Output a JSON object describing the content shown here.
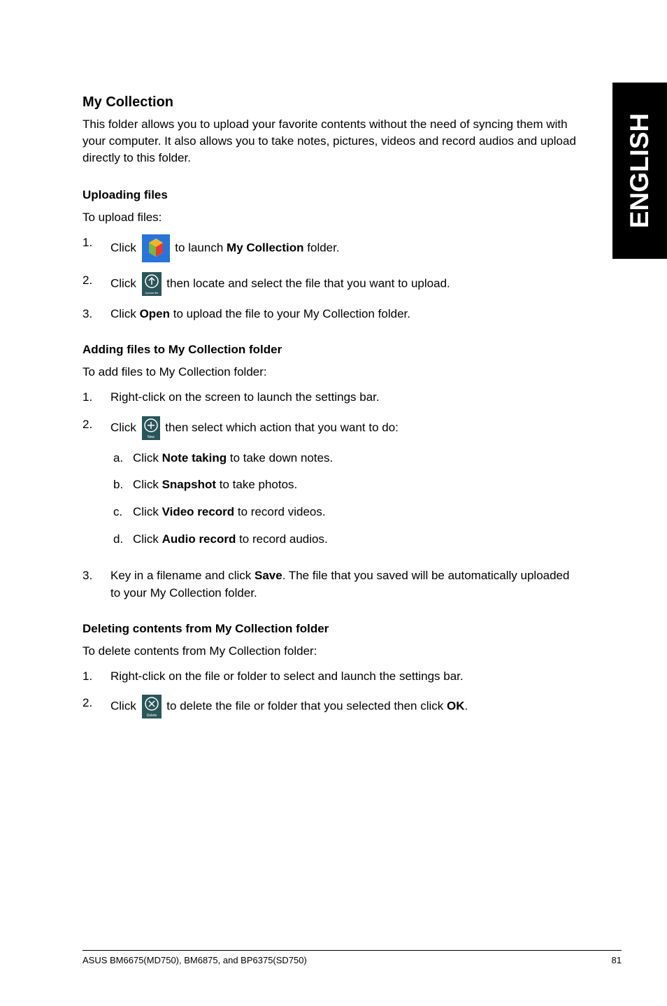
{
  "sideTab": "ENGLISH",
  "title": "My Collection",
  "intro": "This folder allows you to upload your favorite contents without the need of syncing them with your computer. It also allows you to take notes, pictures, videos and record audios and upload directly to this folder.",
  "upload": {
    "heading": "Uploading files",
    "lead": "To upload files:",
    "s1_pre": "Click ",
    "s1_post": " to launch ",
    "s1_bold": "My Collection",
    "s1_end": " folder.",
    "s2_pre": "Click ",
    "s2_post": " then locate and select the file that you want to upload.",
    "s3_a": "Click ",
    "s3_b": "Open",
    "s3_c": " to upload the file to your My Collection folder."
  },
  "adding": {
    "heading": "Adding files to My Collection folder",
    "lead": "To add files to My Collection folder:",
    "s1": "Right-click on the screen to launch the settings bar.",
    "s2_pre": "Click ",
    "s2_post": " then select which action that you want to do:",
    "a_pre": "Click ",
    "a_b": "Note taking",
    "a_post": " to take down notes.",
    "b_pre": "Click ",
    "b_b": "Snapshot",
    "b_post": " to take photos.",
    "c_pre": "Click ",
    "c_b": "Video record",
    "c_post": " to record videos.",
    "d_pre": "Click ",
    "d_b": "Audio record",
    "d_post": " to record audios.",
    "s3_a": "Key in a filename and click ",
    "s3_b": "Save",
    "s3_c": ". The file that you saved will be automatically uploaded to your My Collection folder."
  },
  "deleting": {
    "heading": "Deleting contents from My Collection folder",
    "lead": "To delete contents from My Collection folder:",
    "s1": "Right-click on the file or folder to select and launch the settings bar.",
    "s2_pre": "Click ",
    "s2_mid": " to delete the file or folder that you selected then click ",
    "s2_b": "OK",
    "s2_end": "."
  },
  "footer": {
    "left": "ASUS BM6675(MD750), BM6875, and BP6375(SD750)",
    "right": "81"
  },
  "nums": {
    "n1": "1.",
    "n2": "2.",
    "n3": "3."
  },
  "lets": {
    "a": "a.",
    "b": "b.",
    "c": "c.",
    "d": "d."
  }
}
